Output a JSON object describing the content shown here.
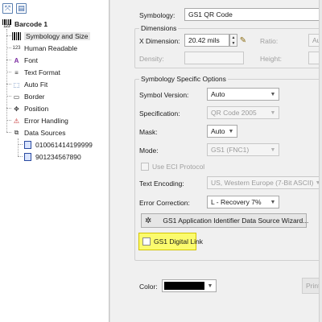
{
  "tree": {
    "items": [
      {
        "label": "Barcode 1",
        "icon": "barcode-root-icon"
      },
      {
        "label": "Symbology and Size",
        "icon": "barcode-icon"
      },
      {
        "label": "Human Readable",
        "icon": "digits-123-icon"
      },
      {
        "label": "Font",
        "icon": "font-icon"
      },
      {
        "label": "Text Format",
        "icon": "text-format-icon"
      },
      {
        "label": "Auto Fit",
        "icon": "auto-fit-icon"
      },
      {
        "label": "Border",
        "icon": "border-icon"
      },
      {
        "label": "Position",
        "icon": "position-icon"
      },
      {
        "label": "Error Handling",
        "icon": "error-handling-icon"
      },
      {
        "label": "Data Sources",
        "icon": "data-sources-icon"
      },
      {
        "label": "010061414199999",
        "icon": "data-source-icon"
      },
      {
        "label": "901234567890",
        "icon": "data-source-icon"
      }
    ],
    "root_glyph": "123",
    "hr_glyph": "123"
  },
  "symbology": {
    "label": "Symbology:",
    "value": "GS1 QR Code"
  },
  "dimensions": {
    "title": "Dimensions",
    "x_dimension": {
      "label": "X Dimension:",
      "value": "20.42 mils"
    },
    "ratio": {
      "label": "Ratio:",
      "value": "Auto"
    },
    "density": {
      "label": "Density:",
      "value": ""
    },
    "height": {
      "label": "Height:",
      "value": ""
    }
  },
  "options": {
    "title": "Symbology Specific Options",
    "symbol_version": {
      "label": "Symbol Version:",
      "value": "Auto"
    },
    "specification": {
      "label": "Specification:",
      "value": "QR Code 2005"
    },
    "mask": {
      "label": "Mask:",
      "value": "Auto"
    },
    "mode": {
      "label": "Mode:",
      "value": "GS1 (FNC1)"
    },
    "use_eci": {
      "label": "Use ECI Protocol"
    },
    "text_encoding": {
      "label": "Text Encoding:",
      "value": "US, Western Europe (7-Bit ASCII)"
    },
    "error_correction": {
      "label": "Error Correction:",
      "value": "L - Recovery 7%"
    },
    "wizard_button": "GS1 Application Identifier Data Source Wizard...",
    "digital_link": {
      "label": "GS1 Digital Link"
    }
  },
  "color": {
    "label": "Color:",
    "value": "#000000"
  },
  "print_button": "Print",
  "colors": {
    "highlight": "#fbfb6e",
    "accent": "#2a5aa0"
  }
}
